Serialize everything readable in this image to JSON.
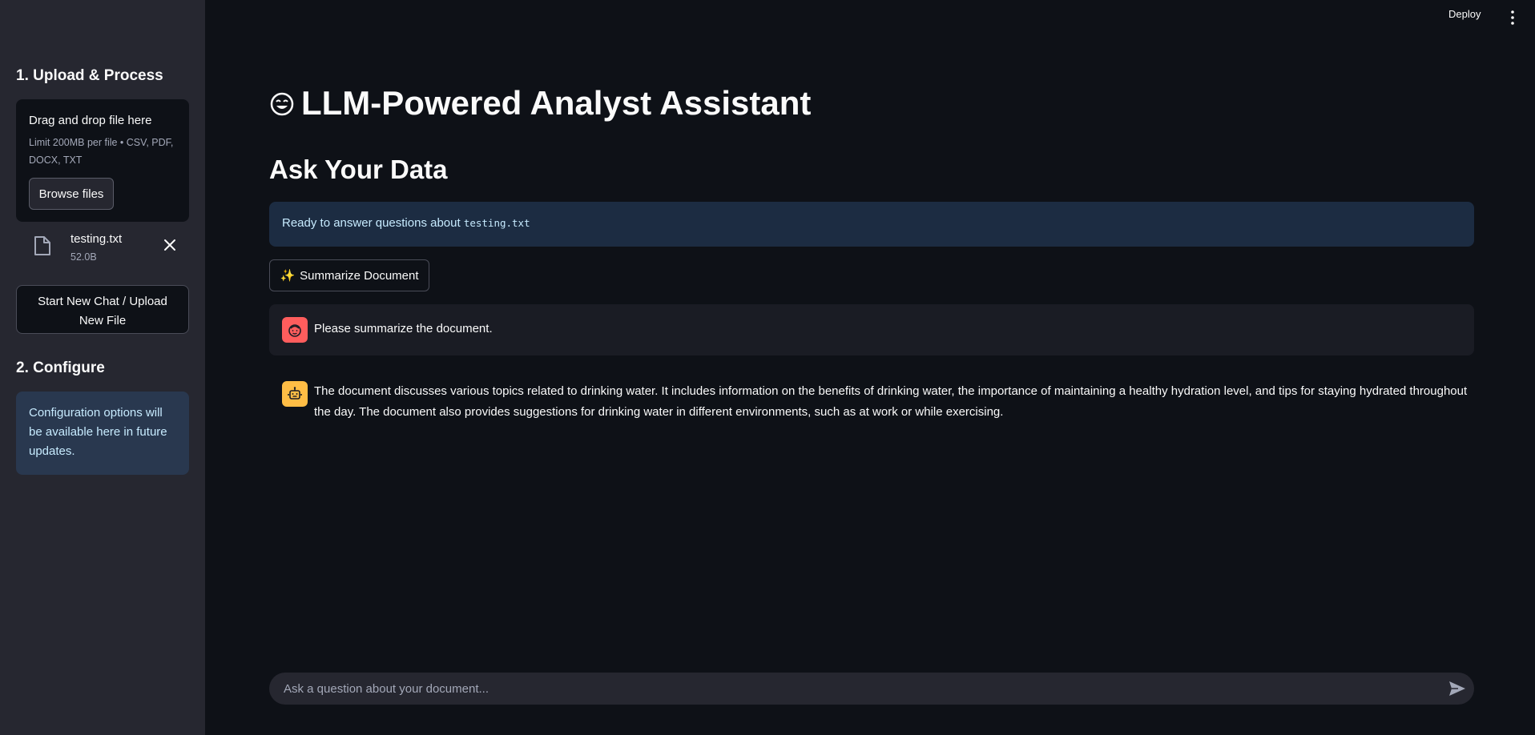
{
  "header": {
    "deploy_label": "Deploy",
    "menu_icon": "vertical-dots-icon"
  },
  "sidebar": {
    "upload_heading": "1. Upload & Process",
    "uploader": {
      "drag_text": "Drag and drop file here",
      "limit_text": "Limit 200MB per file • CSV, PDF, DOCX, TXT",
      "browse_label": "Browse files"
    },
    "uploaded_file": {
      "name": "testing.txt",
      "size": "52.0B",
      "icon": "file-icon"
    },
    "new_chat_label": "Start New Chat / Upload New File",
    "configure_heading": "2. Configure",
    "configure_info": "Configuration options will be available here in future updates."
  },
  "main": {
    "title": "LLM-Powered Analyst Assistant",
    "title_icon": "smiling-face-icon",
    "subheading": "Ask Your Data",
    "ready_text": "Ready to answer questions about ",
    "ready_file": "testing.txt",
    "summarize_label": "Summarize Document",
    "messages": [
      {
        "role": "user",
        "avatar": "user-face-icon",
        "text": "Please summarize the document."
      },
      {
        "role": "assistant",
        "avatar": "robot-icon",
        "text": "The document discusses various topics related to drinking water. It includes information on the benefits of drinking water, the importance of maintaining a healthy hydration level, and tips for staying hydrated throughout the day. The document also provides suggestions for drinking water in different environments, such as at work or while exercising."
      }
    ],
    "chat_input": {
      "placeholder": "Ask a question about your document...",
      "value": ""
    }
  },
  "colors": {
    "background": "#0e1117",
    "sidebar": "#262730",
    "info_box": "#1c2c42",
    "user_avatar": "#ff5d5d",
    "assistant_avatar": "#ffbd45"
  }
}
